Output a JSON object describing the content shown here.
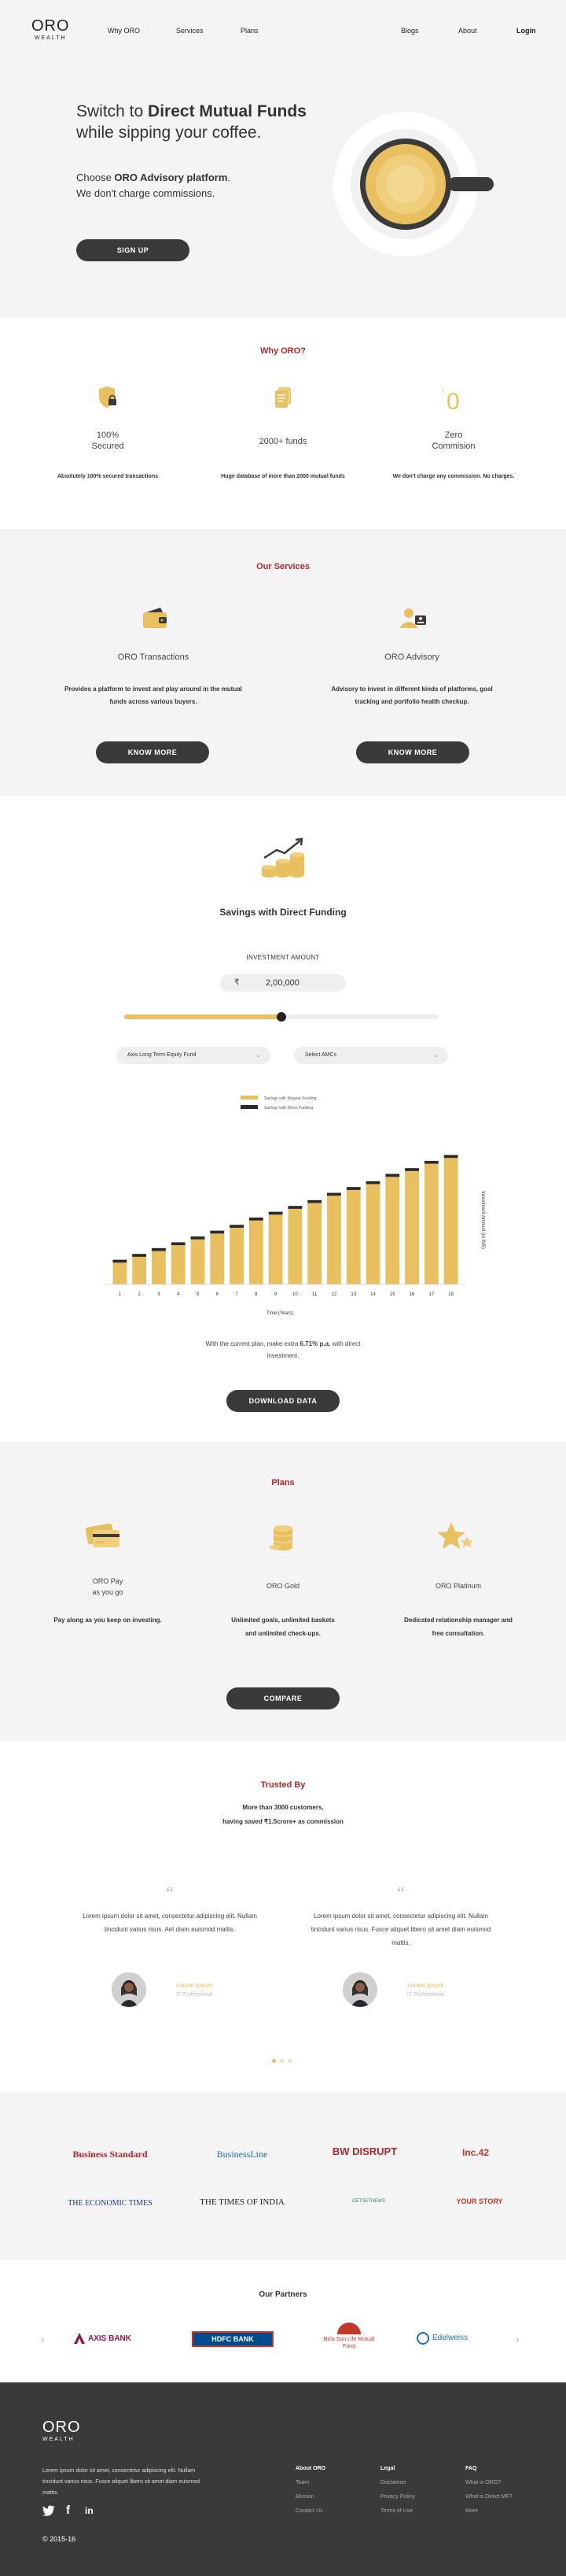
{
  "nav": {
    "logo": "ORO",
    "logo_sub": "WEALTH",
    "why": "Why ORO",
    "services": "Services",
    "plans": "Plans",
    "blogs": "Blogs",
    "about": "About",
    "login": "Login"
  },
  "hero": {
    "line1_prefix": "Switch to ",
    "line1_bold": "Direct Mutual Funds",
    "line2": "while sipping your coffee.",
    "sub1_prefix": "Choose ",
    "sub1_bold": "ORO Advisory platform",
    "sub1_suffix": ".",
    "sub2": "We don't charge commissions.",
    "cta": "SIGN UP"
  },
  "why": {
    "title": "Why ORO?",
    "features": [
      {
        "title": "100%\nSecured",
        "desc": "Absolutely 100% secured transactions"
      },
      {
        "title": "2000+ funds",
        "desc": "Huge database of more than 2000 mutual funds"
      },
      {
        "title": "Zero\nCommision",
        "desc": "We don't charge any commission. No charges."
      }
    ]
  },
  "services": {
    "title": "Our Services",
    "items": [
      {
        "title": "ORO Transactions",
        "desc": "Provides a platform to invest and play around in the mutual funds across various buyers.",
        "cta": "KNOW MORE"
      },
      {
        "title": "ORO Advisory",
        "desc": "Advisory to invest in different kinds of platforms, goal tracking and portfolio health checkup.",
        "cta": "KNOW MORE"
      }
    ]
  },
  "savings": {
    "title": "Savings with Direct Funding",
    "amount_label": "INVESTMENT AMOUNT",
    "currency": "₹",
    "amount": "2,00,000",
    "slider_fraction": 0.5,
    "fund_select": "Axis Long Term Equity Fund",
    "amc_select": "Select AMCs",
    "note_prefix": "With the current plan, make extra ",
    "note_bold": "6.71% p.a.",
    "note_suffix": " with direct investment.",
    "cta": "DOWNLOAD DATA"
  },
  "chart_data": {
    "type": "bar",
    "xlabel": "Time (Years)",
    "ylabel": "Investment Amount (in INR)",
    "categories": [
      "1",
      "2",
      "3",
      "4",
      "5",
      "6",
      "7",
      "8",
      "9",
      "10",
      "11",
      "12",
      "13",
      "14",
      "15",
      "16",
      "17",
      "18"
    ],
    "series": [
      {
        "name": "Savings with Regular Funding",
        "color": "#e8c060",
        "values": [
          15,
          19,
          23,
          27,
          31,
          35,
          39,
          44,
          48,
          52,
          56,
          61,
          65,
          69,
          74,
          78,
          83,
          87
        ]
      },
      {
        "name": "Savings with Direct Funding",
        "color": "#2a2a2a",
        "values": [
          2,
          2,
          2,
          2,
          2,
          2,
          2,
          2,
          2,
          2,
          2,
          2,
          2,
          2,
          2,
          2,
          2,
          2
        ]
      }
    ],
    "ylim": [
      0,
      92
    ],
    "legend": "top-center"
  },
  "plans": {
    "title": "Plans",
    "items": [
      {
        "title": "ORO Pay\nas you go",
        "desc": "Pay along as you keep on investing."
      },
      {
        "title": "ORO Gold",
        "desc": "Unlimited goals, unlimited baskets and unlimited check-ups."
      },
      {
        "title": "ORO Platinum",
        "desc": "Dedicated relationship manager and free consultation."
      }
    ],
    "cta": "COMPARE"
  },
  "trusted": {
    "title": "Trusted By",
    "sub1": "More than 3000 customers,",
    "sub2": "having saved  ₹1.5crore+ as commission",
    "testimonials": [
      {
        "quote": "Lorem ipsum dolor sit amet, consectetur adipiscing elit. Nullam tincidunt varius risus. Aet diam euismod mattis.",
        "name": "Lorem Ipsum",
        "role": "IT Professional"
      },
      {
        "quote": "Lorem ipsum dolor sit amet, consectetur adipiscing elit. Nullam tincidunt varius risus. Fusce aliquet libero sit amet diam euismod mattis.",
        "name": "Lorem Ipsum",
        "role": "IT Professional"
      }
    ]
  },
  "media": [
    {
      "name": "Business Standard",
      "color": "#b3282d"
    },
    {
      "name": "BusinessLine",
      "color": "#1f6fb2"
    },
    {
      "name": "BW DISRUPT",
      "color": "#b3282d"
    },
    {
      "name": "Inc.42",
      "color": "#c0392b"
    },
    {
      "name": "THE ECONOMIC TIMES",
      "color": "#1a3d7c"
    },
    {
      "name": "THE TIMES OF INDIA",
      "color": "#222222"
    },
    {
      "name": "GETSETNEWS",
      "color": "#2a8a6a"
    },
    {
      "name": "YOUR STORY",
      "color": "#c0392b"
    }
  ],
  "partners": {
    "title": "Our Partners",
    "items": [
      {
        "name": "AXIS BANK",
        "color": "#97144d"
      },
      {
        "name": "HDFC BANK",
        "color": "#004c8f"
      },
      {
        "name": "Birla Sun Life Mutual Fund",
        "color": "#c0392b"
      },
      {
        "name": "Edelweiss",
        "color": "#1f6fb2"
      }
    ]
  },
  "footer": {
    "logo": "ORO",
    "logo_sub": "WEALTH",
    "text": "Lorem ipsum dolor sit amet, consectetur adipiscing elit. Nullam tincidunt varius risus. Fusce aliquet libero sit amet diam euismod mattis.",
    "col1": {
      "head": "About ORO",
      "links": [
        "Team",
        "Mission",
        "Contact Us"
      ]
    },
    "col2": {
      "head": "Legal",
      "links": [
        "Disclaimer",
        "Privacy Policy",
        "Terms of Use"
      ]
    },
    "col3": {
      "head": "FAQ",
      "links": [
        "What is ORO?",
        "What is Direct MF?",
        "More"
      ]
    },
    "copyright": "© 2015-16"
  }
}
